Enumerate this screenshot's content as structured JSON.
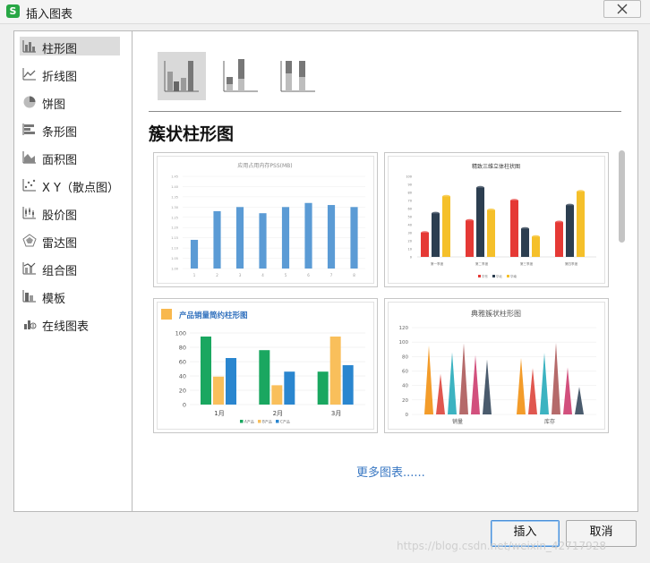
{
  "window": {
    "title": "插入图表",
    "app_icon_letter": "S"
  },
  "sidebar": {
    "items": [
      {
        "label": "柱形图",
        "icon": "column-chart-icon",
        "active": true
      },
      {
        "label": "折线图",
        "icon": "line-chart-icon"
      },
      {
        "label": "饼图",
        "icon": "pie-chart-icon"
      },
      {
        "label": "条形图",
        "icon": "bar-chart-icon"
      },
      {
        "label": "面积图",
        "icon": "area-chart-icon"
      },
      {
        "label": "X Y（散点图）",
        "icon": "scatter-chart-icon"
      },
      {
        "label": "股价图",
        "icon": "stock-chart-icon"
      },
      {
        "label": "雷达图",
        "icon": "radar-chart-icon"
      },
      {
        "label": "组合图",
        "icon": "combo-chart-icon"
      },
      {
        "label": "模板",
        "icon": "template-icon"
      },
      {
        "label": "在线图表",
        "icon": "online-chart-icon"
      }
    ]
  },
  "subtypes": [
    "clustered-column",
    "stacked-column",
    "percent-stacked-column"
  ],
  "section_title": "簇状柱形图",
  "thumbnails": {
    "t1": {
      "title": "应用占用内存PSS(MB)",
      "y_ticks": [
        "1.00",
        "1.05",
        "1.10",
        "1.15",
        "1.20",
        "1.25",
        "1.30",
        "1.35",
        "1.40",
        "1.45"
      ],
      "categories": [
        "1",
        "2",
        "3",
        "4",
        "5",
        "6",
        "7",
        "8"
      ],
      "values": [
        1.14,
        1.28,
        1.3,
        1.27,
        1.3,
        1.32,
        1.31,
        1.3
      ]
    },
    "t2": {
      "title": "精致三维立体柱状图",
      "y_ticks": [
        "0",
        "10",
        "20",
        "30",
        "40",
        "50",
        "60",
        "70",
        "80",
        "90",
        "100"
      ],
      "categories": [
        "第一季度",
        "第二季度",
        "第三季度",
        "第四季度"
      ],
      "series": [
        {
          "name": "华东",
          "color": "#e53935",
          "values": [
            30,
            45,
            70,
            43
          ]
        },
        {
          "name": "华北",
          "color": "#2c3e50",
          "values": [
            54,
            86,
            35,
            64
          ]
        },
        {
          "name": "华南",
          "color": "#f5c02a",
          "values": [
            75,
            58,
            25,
            81
          ]
        }
      ]
    },
    "t3": {
      "title": "产品销量简约柱形图",
      "accent": "#f8b84e",
      "y_ticks": [
        "0",
        "20",
        "40",
        "60",
        "80",
        "100"
      ],
      "categories": [
        "1月",
        "2月",
        "3月"
      ],
      "series": [
        {
          "name": "A产品",
          "color": "#1aa760",
          "values": [
            95,
            76,
            46
          ]
        },
        {
          "name": "B产品",
          "color": "#f9bf5b",
          "values": [
            39,
            27,
            95
          ]
        },
        {
          "name": "C产品",
          "color": "#2a86cf",
          "values": [
            65,
            46,
            55
          ]
        }
      ]
    },
    "t4": {
      "title": "典雅簇状柱形图",
      "y_ticks": [
        "0",
        "20",
        "40",
        "60",
        "80",
        "100",
        "120"
      ],
      "categories": [
        "销量",
        "库存"
      ],
      "colors": [
        "#f39c2a",
        "#e0574f",
        "#3cb3c1",
        "#b56a6a",
        "#d2507d",
        "#4a5b6d"
      ],
      "groups": [
        [
          95,
          56,
          86,
          98,
          82,
          76
        ],
        [
          78,
          64,
          85,
          99,
          65,
          38
        ]
      ]
    }
  },
  "more_link": "更多图表......",
  "buttons": {
    "insert": "插入",
    "cancel": "取消"
  },
  "watermark": "https://blog.csdn.net/weixin_42717928"
}
